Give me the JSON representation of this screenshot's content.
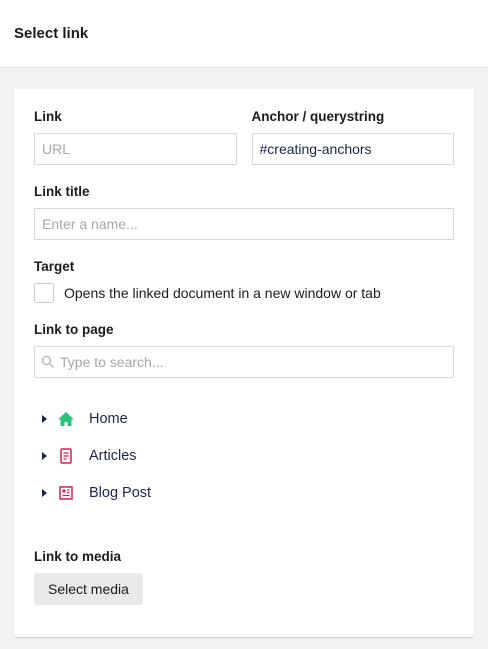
{
  "header": {
    "title": "Select link"
  },
  "link": {
    "label": "Link",
    "placeholder": "URL",
    "value": ""
  },
  "anchor": {
    "label": "Anchor / querystring",
    "value": "#creating-anchors"
  },
  "link_title": {
    "label": "Link title",
    "placeholder": "Enter a name..."
  },
  "target": {
    "label": "Target",
    "checkbox_label": "Opens the linked document in a new window or tab"
  },
  "link_to_page": {
    "label": "Link to page",
    "search_placeholder": "Type to search..."
  },
  "tree": {
    "items": [
      {
        "label": "Home",
        "icon": "home-icon",
        "color": "#2bc37c"
      },
      {
        "label": "Articles",
        "icon": "document-list-icon",
        "color": "#d42054"
      },
      {
        "label": "Blog Post",
        "icon": "newspaper-icon",
        "color": "#d42054"
      }
    ]
  },
  "link_to_media": {
    "label": "Link to media",
    "button_label": "Select media"
  }
}
